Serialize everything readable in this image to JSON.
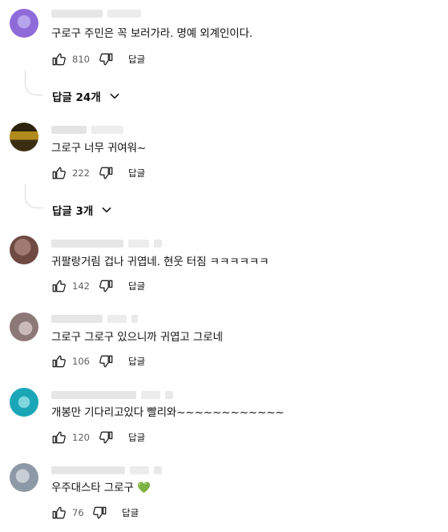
{
  "comments": [
    {
      "text": "구로구 주민은 꼭 보러가라. 명예 외계인이다.",
      "likes": "810",
      "reply_label": "답글",
      "replies_label": "답글 24개",
      "avatar_colors": [
        "#8e6bd9",
        "#b8a4ec"
      ]
    },
    {
      "text": "그로구 너무 귀여워~",
      "likes": "222",
      "reply_label": "답글",
      "replies_label": "답글 3개",
      "avatar_colors": [
        "#3a2e12",
        "#b08a1c"
      ]
    },
    {
      "text": "귀팔랑거림 겁나 귀엽네. 현웃 터짐 ㅋㅋㅋㅋㅋㅋ",
      "likes": "142",
      "reply_label": "답글",
      "avatar_colors": [
        "#6e4a42",
        "#a07a70"
      ]
    },
    {
      "text": "그로구 그로구 있으니까 귀엽고 그로네",
      "likes": "106",
      "reply_label": "답글",
      "avatar_colors": [
        "#8d7878",
        "#c9b9b9"
      ]
    },
    {
      "text": "개봉만 기다리고있다 빨리와~~~~~~~~~~~~",
      "likes": "120",
      "reply_label": "답글",
      "avatar_colors": [
        "#1aa6b7",
        "#7fd6de"
      ]
    },
    {
      "text": "우주대스타 그로구 💚",
      "likes": "76",
      "reply_label": "답글",
      "avatar_colors": [
        "#8e99a8",
        "#c8ced6"
      ]
    }
  ]
}
